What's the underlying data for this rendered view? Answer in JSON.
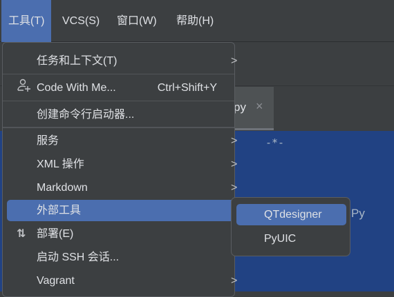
{
  "menubar": [
    {
      "label": "工具(T)",
      "active": true
    },
    {
      "label": "VCS(S)"
    },
    {
      "label": "窗口(W)"
    },
    {
      "label": "帮助(H)"
    }
  ],
  "tab": {
    "label": "py",
    "close": "×"
  },
  "editor": {
    "comment": "-*-",
    "peek": "Py"
  },
  "colors": {
    "accent": "#4b6eaf",
    "menu_bg": "#3c3f41",
    "editor_bg": "#214283"
  },
  "menu": {
    "items": [
      {
        "label": "任务和上下文(T)",
        "arrow": ">"
      },
      {
        "label": "Code With Me...",
        "shortcut": "Ctrl+Shift+Y",
        "icon": "add-user-icon"
      },
      {
        "label": "创建命令行启动器..."
      },
      {
        "label": "服务",
        "arrow": ">"
      },
      {
        "label": "XML 操作",
        "arrow": ">"
      },
      {
        "label": "Markdown",
        "arrow": ">"
      },
      {
        "label": "外部工具",
        "arrow": ">",
        "highlighted": true
      },
      {
        "label": "部署(E)",
        "arrow": ">",
        "icon": "deploy-arrows-icon"
      },
      {
        "label": "启动 SSH 会话..."
      },
      {
        "label": "Vagrant",
        "arrow": ">"
      }
    ]
  },
  "submenu": {
    "items": [
      {
        "label": "QTdesigner",
        "highlighted": true
      },
      {
        "label": "PyUIC"
      }
    ]
  }
}
